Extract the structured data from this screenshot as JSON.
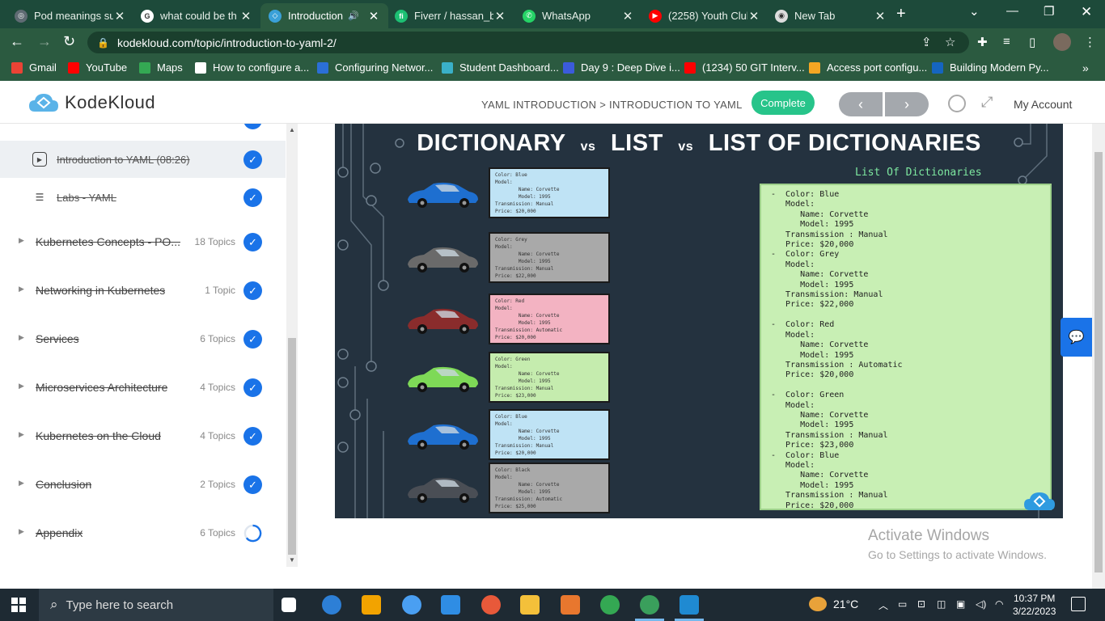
{
  "browser": {
    "tabs": [
      {
        "title": "Pod meanings su",
        "fav_color": "#5f6b73",
        "fav_glyph": "◎",
        "active": false
      },
      {
        "title": "what could be th",
        "fav_color": "#ffffff",
        "fav_glyph": "G",
        "active": false
      },
      {
        "title": "Introduction",
        "fav_color": "#3aa0d8",
        "fav_glyph": "◇",
        "active": true,
        "audio": true
      },
      {
        "title": "Fiverr / hassan_b",
        "fav_color": "#1dbf73",
        "fav_glyph": "fi",
        "active": false
      },
      {
        "title": "WhatsApp",
        "fav_color": "#25d366",
        "fav_glyph": "✆",
        "active": false
      },
      {
        "title": "(2258) Youth Clul",
        "fav_color": "#ff0000",
        "fav_glyph": "▶",
        "active": false
      },
      {
        "title": "New Tab",
        "fav_color": "#dddddd",
        "fav_glyph": "◉",
        "active": false
      }
    ],
    "url": "kodekloud.com/topic/introduction-to-yaml-2/",
    "bookmarks": [
      {
        "label": "Gmail",
        "color": "#ea4335"
      },
      {
        "label": "YouTube",
        "color": "#ff0000"
      },
      {
        "label": "Maps",
        "color": "#34a853"
      },
      {
        "label": "How to configure a...",
        "color": "#ffffff"
      },
      {
        "label": "Configuring Networ...",
        "color": "#2b6fd6"
      },
      {
        "label": "Student Dashboard...",
        "color": "#3ab0c8"
      },
      {
        "label": "Day 9 : Deep Dive i...",
        "color": "#3b5bdb"
      },
      {
        "label": "(1234) 50 GIT Interv...",
        "color": "#ff0000"
      },
      {
        "label": "Access port configu...",
        "color": "#f5a623"
      },
      {
        "label": "Building Modern Py...",
        "color": "#1565c0"
      }
    ]
  },
  "site": {
    "brand": "KodeKloud",
    "breadcrumb": "YAML INTRODUCTION > INTRODUCTION TO YAML",
    "complete_label": "Complete",
    "prev_label": "‹",
    "next_label": "›",
    "account_label": "My Account"
  },
  "sidebar": {
    "lessons": [
      {
        "label": "Introduction to YAML (08:26)",
        "icon": "play-icon",
        "current": true
      },
      {
        "label": "Labs - YAML",
        "icon": "list-icon",
        "current": false
      }
    ],
    "topics": [
      {
        "label": "Kubernetes Concepts - PO...",
        "count": "18 Topics",
        "status": "complete"
      },
      {
        "label": "Networking in Kubernetes",
        "count": "1 Topic",
        "status": "complete"
      },
      {
        "label": "Services",
        "count": "6 Topics",
        "status": "complete"
      },
      {
        "label": "Microservices Architecture",
        "count": "4 Topics",
        "status": "complete"
      },
      {
        "label": "Kubernetes on the Cloud",
        "count": "4 Topics",
        "status": "complete"
      },
      {
        "label": "Conclusion",
        "count": "2 Topics",
        "status": "complete"
      },
      {
        "label": "Appendix",
        "count": "6 Topics",
        "status": "in-progress"
      }
    ]
  },
  "slide": {
    "title_a": "DICTIONARY",
    "vs1": "vs",
    "title_b": "LIST",
    "vs2": "vs",
    "title_c": "LIST OF DICTIONARIES",
    "list_title": "List Of Dictionaries",
    "cards": [
      {
        "color_name": "Blue",
        "bg": "#bfe3f5",
        "car_color": "#1e6fd0",
        "text": "Color: Blue\nModel:\n        Name: Corvette\n        Model: 1995\nTransmission: Manual\nPrice: $20,000"
      },
      {
        "color_name": "Grey",
        "bg": "#a9a9a9",
        "car_color": "#6a6a6a",
        "text": "Color: Grey\nModel:\n        Name: Corvette\n        Model: 1995\nTransmission: Manual\nPrice: $22,000"
      },
      {
        "color_name": "Red",
        "bg": "#f3b3c2",
        "car_color": "#8a2c2c",
        "text": "Color: Red\nModel:\n        Name: Corvette\n        Model: 1995\nTransmission: Automatic\nPrice: $20,000"
      },
      {
        "color_name": "Green",
        "bg": "#c5ecae",
        "car_color": "#7ed957",
        "text": "Color: Green\nModel:\n        Name: Corvette\n        Model: 1995\nTransmission: Manual\nPrice: $23,000"
      },
      {
        "color_name": "Blue",
        "bg": "#bfe3f5",
        "car_color": "#1e6fd0",
        "text": "Color: Blue\nModel:\n        Name: Corvette\n        Model: 1995\nTransmission: Manual\nPrice: $20,000"
      },
      {
        "color_name": "Black",
        "bg": "#a9a9a9",
        "car_color": "#4a4e55",
        "text": "Color: Black\nModel:\n        Name: Corvette\n        Model: 1995\nTransmission: Automatic\nPrice: $25,000"
      }
    ],
    "list_text": "-  Color: Blue\n   Model:\n      Name: Corvette\n      Model: 1995\n   Transmission : Manual\n   Price: $20,000\n-  Color: Grey\n   Model:\n      Name: Corvette\n      Model: 1995\n   Transmission: Manual\n   Price: $22,000\n\n-  Color: Red\n   Model:\n      Name: Corvette\n      Model: 1995\n   Transmission : Automatic\n   Price: $20,000\n\n-  Color: Green\n   Model:\n      Name: Corvette\n      Model: 1995\n   Transmission : Manual\n   Price: $23,000\n-  Color: Blue\n   Model:\n      Name: Corvette\n      Model: 1995\n   Transmission : Manual\n   Price: $20,000"
  },
  "watermark": {
    "line1": "Activate Windows",
    "line2": "Go to Settings to activate Windows."
  },
  "taskbar": {
    "search_placeholder": "Type here to search",
    "temperature": "21°C",
    "time": "10:37 PM",
    "date": "3/22/2023"
  }
}
